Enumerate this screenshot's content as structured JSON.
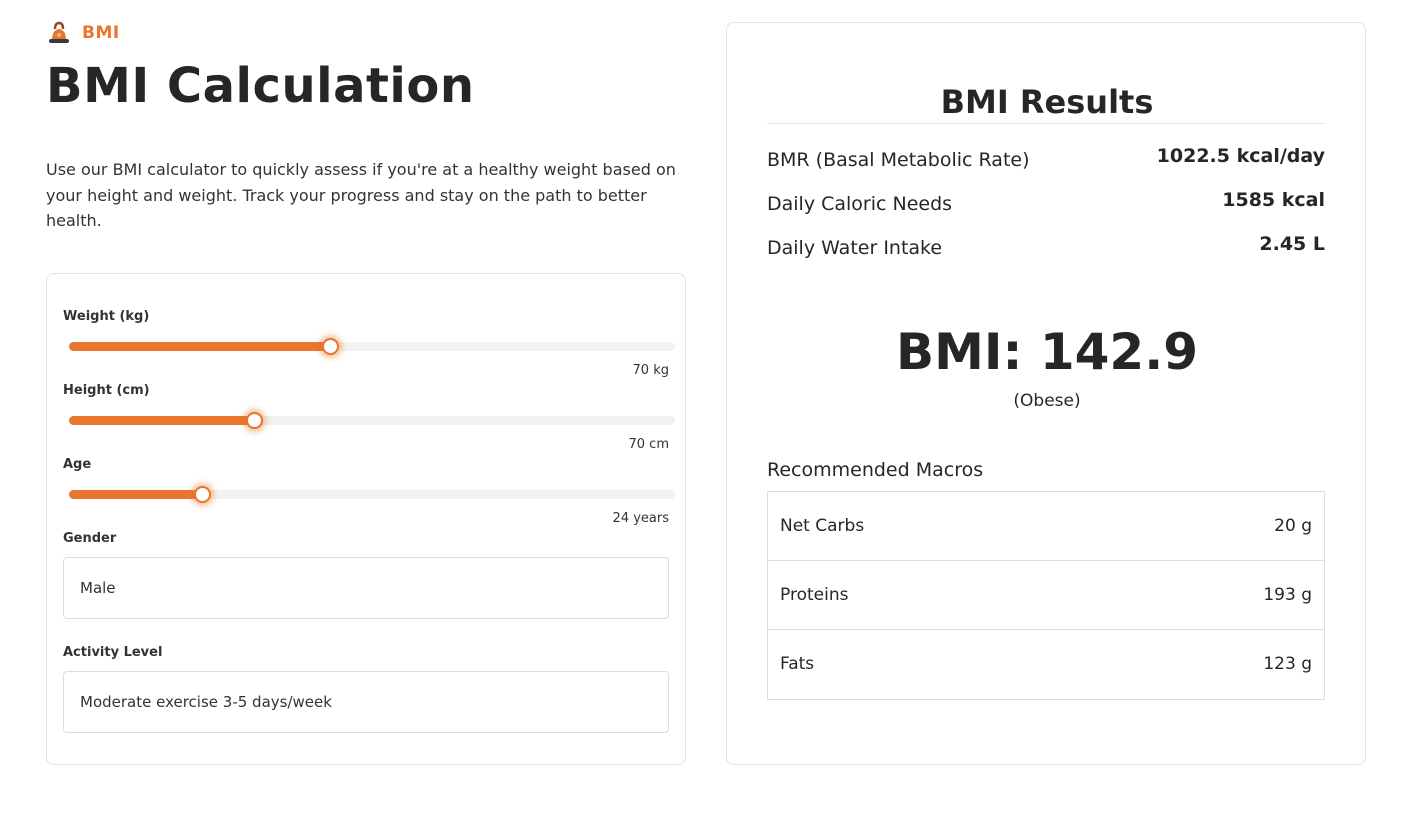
{
  "brand": {
    "label": "BMI",
    "icon": "kettlebell-icon",
    "accent_color": "#e8762e"
  },
  "page": {
    "title": "BMI Calculation",
    "intro": "Use our BMI calculator to quickly assess if you're at a healthy weight based on your height and weight. Track your progress and stay on the path to better health."
  },
  "form": {
    "weight": {
      "label": "Weight (kg)",
      "value_text": "70 kg",
      "fill_fraction": 0.43
    },
    "height": {
      "label": "Height (cm)",
      "value_text": "70 cm",
      "fill_fraction": 0.305
    },
    "age": {
      "label": "Age",
      "value_text": "24 years",
      "fill_fraction": 0.22
    },
    "gender": {
      "label": "Gender",
      "selected": "Male"
    },
    "activity": {
      "label": "Activity Level",
      "selected": "Moderate exercise 3-5 days/week"
    }
  },
  "results": {
    "title": "BMI Results",
    "stats": [
      {
        "label": "BMR (Basal Metabolic Rate)",
        "value": "1022.5 kcal/day"
      },
      {
        "label": "Daily Caloric Needs",
        "value": "1585 kcal"
      },
      {
        "label": "Daily Water Intake",
        "value": "2.45 L"
      }
    ],
    "bmi_text": "BMI: 142.9",
    "bmi_category": "(Obese)",
    "macros_title": "Recommended Macros",
    "macros": [
      {
        "name": "Net Carbs",
        "amount": "20 g"
      },
      {
        "name": "Proteins",
        "amount": "193 g"
      },
      {
        "name": "Fats",
        "amount": "123 g"
      }
    ]
  }
}
